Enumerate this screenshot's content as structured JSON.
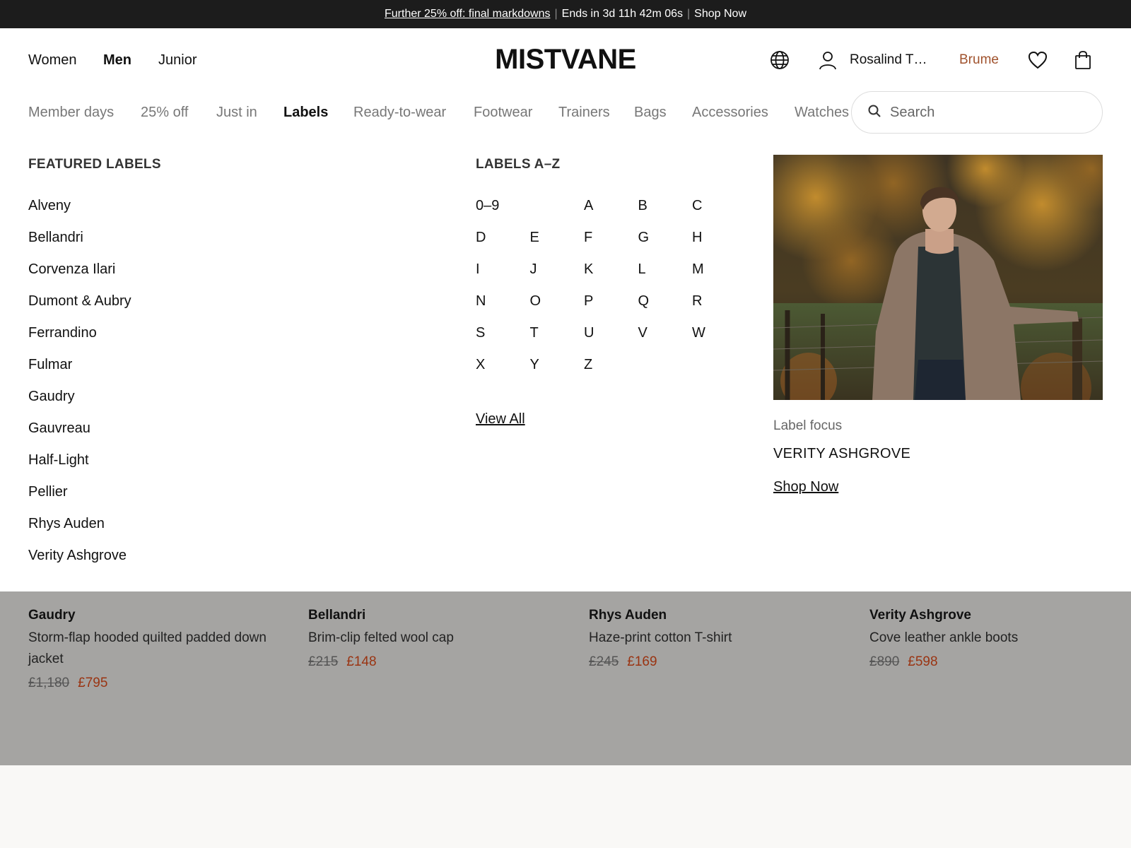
{
  "promo": {
    "link": "Further 25% off: final markdowns",
    "sep": "|",
    "countdown": "Ends in 3d 11h 42m 06s",
    "shop": "Shop Now"
  },
  "header": {
    "genders": [
      "Women",
      "Men",
      "Junior"
    ],
    "logo": "MISTVANE",
    "user": "Rosalind T…",
    "brume": "Brume"
  },
  "categories": [
    "Member days",
    "25% off",
    "Just in",
    "Labels",
    "Ready-to-wear",
    "Footwear",
    "Trainers",
    "Bags",
    "Accessories",
    "Watches"
  ],
  "search": {
    "placeholder": "Search"
  },
  "featured": {
    "title": "FEATURED LABELS",
    "items": [
      "Alveny",
      "Bellandri",
      "Corvenza Ilari",
      "Dumont & Aubry",
      "Ferrandino",
      "Fulmar",
      "Gaudry",
      "Gauvreau",
      "Half-Light",
      "Pellier",
      "Rhys Auden",
      "Verity Ashgrove"
    ]
  },
  "az": {
    "title": "LABELS A–Z",
    "letters": [
      "0–9",
      "",
      "A",
      "B",
      "C",
      "D",
      "E",
      "F",
      "G",
      "H",
      "I",
      "J",
      "K",
      "L",
      "M",
      "N",
      "O",
      "P",
      "Q",
      "R",
      "S",
      "T",
      "U",
      "V",
      "W",
      "X",
      "Y",
      "Z"
    ],
    "view_all": "View All"
  },
  "focus": {
    "label": "Label focus",
    "name": "VERITY ASHGROVE",
    "shop": "Shop Now"
  },
  "products": [
    {
      "brand": "Gaudry",
      "name": "Storm-flap hooded quilted padded down jacket",
      "old": "£1,180",
      "new": "£795"
    },
    {
      "brand": "Bellandri",
      "name": "Brim-clip felted wool cap",
      "old": "£215",
      "new": "£148"
    },
    {
      "brand": "Rhys Auden",
      "name": "Haze-print cotton T-shirt",
      "old": "£245",
      "new": "£169"
    },
    {
      "brand": "Verity Ashgrove",
      "name": "Cove leather ankle boots",
      "old": "£890",
      "new": "£598"
    }
  ],
  "colors": {
    "accent": "#a0522d",
    "sale": "#9a3412",
    "promo_bg": "#1c1c1c"
  }
}
